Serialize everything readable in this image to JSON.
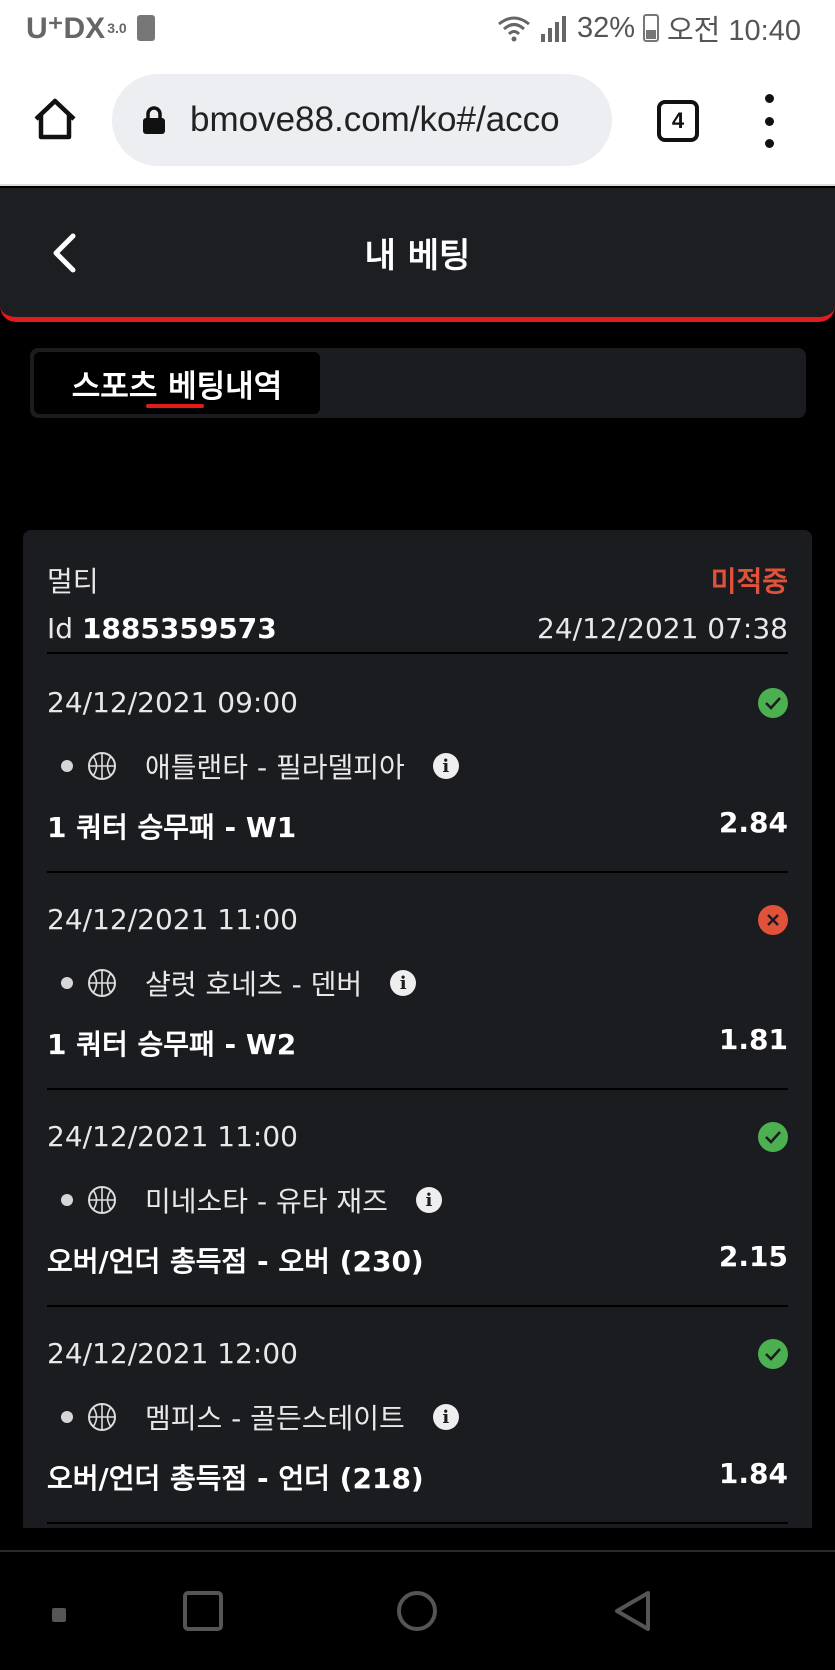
{
  "status_bar": {
    "carrier": "U⁺DX",
    "carrier_version": "3.0",
    "battery": "32%",
    "time": "오전 10:40"
  },
  "browser": {
    "url": "bmove88.com/ko#/acco",
    "tab_count": "4"
  },
  "header": {
    "title": "내 베팅"
  },
  "tabs": {
    "active_label": "스포츠 베팅내역"
  },
  "bet": {
    "type": "멀티",
    "status": "미적중",
    "id_label": "Id",
    "id_value": "1885359573",
    "placed_at": "24/12/2021 07:38",
    "selections": [
      {
        "time": "24/12/2021 09:00",
        "result": "win",
        "match": "애틀랜타 - 필라델피아",
        "market": "1 쿼터 승무패 - W1",
        "odds": "2.84"
      },
      {
        "time": "24/12/2021 11:00",
        "result": "lose",
        "match": "샬럿 호네츠 - 덴버",
        "market": "1 쿼터 승무패 - W2",
        "odds": "1.81"
      },
      {
        "time": "24/12/2021 11:00",
        "result": "win",
        "match": "미네소타 - 유타 재즈",
        "market": "오버/언더 총득점 - 오버 (230)",
        "odds": "2.15"
      },
      {
        "time": "24/12/2021 12:00",
        "result": "win",
        "match": "멤피스 - 골든스테이트",
        "market": "오버/언더 총득점 - 언더 (218)",
        "odds": "1.84"
      }
    ]
  },
  "colors": {
    "accent_red": "#e21b1b",
    "status_lost": "#e0533a",
    "win_green": "#4caf50",
    "card_bg": "#1b1c20"
  },
  "icons": {
    "home": "home-icon",
    "lock": "lock-icon",
    "back": "chevron-left-icon",
    "sport": "basketball-icon",
    "info": "info-icon",
    "win": "check-circle-icon",
    "lose": "x-circle-icon"
  }
}
